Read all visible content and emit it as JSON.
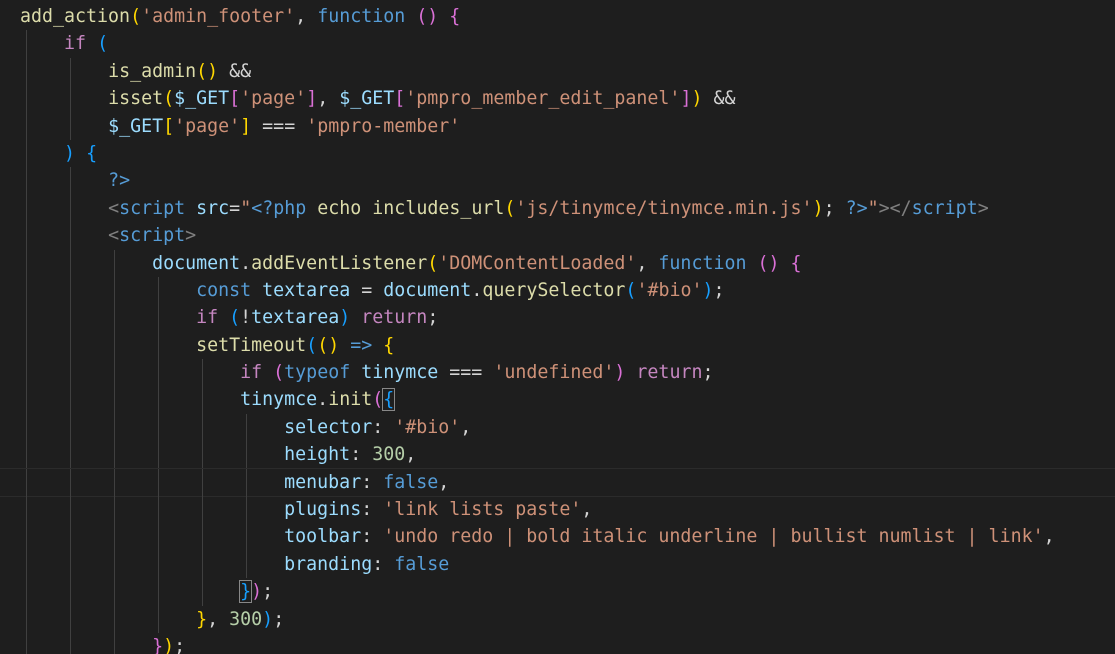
{
  "editor": {
    "theme_colors": {
      "background": "#1e1e1e",
      "function": "#dcdcaa",
      "string": "#ce9178",
      "keyword": "#569cd6",
      "control": "#c586c0",
      "variable": "#9cdcfe",
      "number": "#b5cea8"
    },
    "cursor_line": 17,
    "lines": [
      {
        "indent": 0,
        "tokens": [
          [
            "fn",
            "add_action"
          ],
          [
            "br1",
            "("
          ],
          [
            "str",
            "'admin_footer'"
          ],
          [
            "punc",
            ", "
          ],
          [
            "kw",
            "function"
          ],
          [
            "punc",
            " "
          ],
          [
            "br2",
            "()"
          ],
          [
            "punc",
            " "
          ],
          [
            "br2",
            "{"
          ]
        ]
      },
      {
        "indent": 1,
        "tokens": [
          [
            "ctl",
            "if"
          ],
          [
            "punc",
            " "
          ],
          [
            "br3",
            "("
          ]
        ]
      },
      {
        "indent": 2,
        "tokens": [
          [
            "fn",
            "is_admin"
          ],
          [
            "br1",
            "()"
          ],
          [
            "punc",
            " &&"
          ]
        ]
      },
      {
        "indent": 2,
        "tokens": [
          [
            "fn",
            "isset"
          ],
          [
            "br1",
            "("
          ],
          [
            "var",
            "$_GET"
          ],
          [
            "br2",
            "["
          ],
          [
            "str",
            "'page'"
          ],
          [
            "br2",
            "]"
          ],
          [
            "punc",
            ", "
          ],
          [
            "var",
            "$_GET"
          ],
          [
            "br2",
            "["
          ],
          [
            "str",
            "'pmpro_member_edit_panel'"
          ],
          [
            "br2",
            "]"
          ],
          [
            "br1",
            ")"
          ],
          [
            "punc",
            " &&"
          ]
        ]
      },
      {
        "indent": 2,
        "tokens": [
          [
            "var",
            "$_GET"
          ],
          [
            "br1",
            "["
          ],
          [
            "str",
            "'page'"
          ],
          [
            "br1",
            "]"
          ],
          [
            "punc",
            " === "
          ],
          [
            "str",
            "'pmpro-member'"
          ]
        ]
      },
      {
        "indent": 1,
        "tokens": [
          [
            "br3",
            ")"
          ],
          [
            "punc",
            " "
          ],
          [
            "br3",
            "{"
          ]
        ]
      },
      {
        "indent": 2,
        "tokens": [
          [
            "tag",
            "?>"
          ]
        ]
      },
      {
        "indent": 2,
        "tokens": [
          [
            "tagbr",
            "<"
          ],
          [
            "tag",
            "script"
          ],
          [
            "punc",
            " "
          ],
          [
            "var",
            "src"
          ],
          [
            "punc",
            "="
          ],
          [
            "str",
            "\""
          ],
          [
            "tag",
            "<?php"
          ],
          [
            "punc",
            " "
          ],
          [
            "fn",
            "echo"
          ],
          [
            "punc",
            " "
          ],
          [
            "fn",
            "includes_url"
          ],
          [
            "br1",
            "("
          ],
          [
            "str",
            "'js/tinymce/tinymce.min.js'"
          ],
          [
            "br1",
            ")"
          ],
          [
            "punc",
            "; "
          ],
          [
            "tag",
            "?>"
          ],
          [
            "str",
            "\""
          ],
          [
            "tagbr",
            "></"
          ],
          [
            "tag",
            "script"
          ],
          [
            "tagbr",
            ">"
          ]
        ]
      },
      {
        "indent": 2,
        "tokens": [
          [
            "tagbr",
            "<"
          ],
          [
            "tag",
            "script"
          ],
          [
            "tagbr",
            ">"
          ]
        ]
      },
      {
        "indent": 3,
        "tokens": [
          [
            "var",
            "document"
          ],
          [
            "punc",
            "."
          ],
          [
            "fn",
            "addEventListener"
          ],
          [
            "br1",
            "("
          ],
          [
            "str",
            "'DOMContentLoaded'"
          ],
          [
            "punc",
            ", "
          ],
          [
            "kw",
            "function"
          ],
          [
            "punc",
            " "
          ],
          [
            "br2",
            "()"
          ],
          [
            "punc",
            " "
          ],
          [
            "br2",
            "{"
          ]
        ]
      },
      {
        "indent": 4,
        "tokens": [
          [
            "kw",
            "const"
          ],
          [
            "punc",
            " "
          ],
          [
            "var",
            "textarea"
          ],
          [
            "punc",
            " = "
          ],
          [
            "var",
            "document"
          ],
          [
            "punc",
            "."
          ],
          [
            "fn",
            "querySelector"
          ],
          [
            "br3",
            "("
          ],
          [
            "str",
            "'#bio'"
          ],
          [
            "br3",
            ")"
          ],
          [
            "punc",
            ";"
          ]
        ]
      },
      {
        "indent": 4,
        "tokens": [
          [
            "ctl",
            "if"
          ],
          [
            "punc",
            " "
          ],
          [
            "br3",
            "("
          ],
          [
            "punc",
            "!"
          ],
          [
            "var",
            "textarea"
          ],
          [
            "br3",
            ")"
          ],
          [
            "punc",
            " "
          ],
          [
            "ctl",
            "return"
          ],
          [
            "punc",
            ";"
          ]
        ]
      },
      {
        "indent": 4,
        "tokens": [
          [
            "fn",
            "setTimeout"
          ],
          [
            "br3",
            "("
          ],
          [
            "br1",
            "()"
          ],
          [
            "punc",
            " "
          ],
          [
            "kw",
            "=>"
          ],
          [
            "punc",
            " "
          ],
          [
            "br1",
            "{"
          ]
        ]
      },
      {
        "indent": 5,
        "tokens": [
          [
            "ctl",
            "if"
          ],
          [
            "punc",
            " "
          ],
          [
            "br2",
            "("
          ],
          [
            "kw",
            "typeof"
          ],
          [
            "punc",
            " "
          ],
          [
            "var",
            "tinymce"
          ],
          [
            "punc",
            " === "
          ],
          [
            "str",
            "'undefined'"
          ],
          [
            "br2",
            ")"
          ],
          [
            "punc",
            " "
          ],
          [
            "ctl",
            "return"
          ],
          [
            "punc",
            ";"
          ]
        ]
      },
      {
        "indent": 5,
        "tokens": [
          [
            "var",
            "tinymce"
          ],
          [
            "punc",
            "."
          ],
          [
            "fn",
            "init"
          ],
          [
            "br2",
            "("
          ],
          [
            "br3m",
            "{"
          ]
        ]
      },
      {
        "indent": 6,
        "tokens": [
          [
            "var",
            "selector"
          ],
          [
            "punc",
            ": "
          ],
          [
            "str",
            "'#bio'"
          ],
          [
            "punc",
            ","
          ]
        ]
      },
      {
        "indent": 6,
        "tokens": [
          [
            "var",
            "height"
          ],
          [
            "punc",
            ": "
          ],
          [
            "num",
            "300"
          ],
          [
            "punc",
            ","
          ]
        ]
      },
      {
        "indent": 6,
        "tokens": [
          [
            "var",
            "menubar"
          ],
          [
            "punc",
            ": "
          ],
          [
            "kw",
            "false"
          ],
          [
            "punc",
            ","
          ]
        ]
      },
      {
        "indent": 6,
        "tokens": [
          [
            "var",
            "plugins"
          ],
          [
            "punc",
            ": "
          ],
          [
            "str",
            "'link lists paste'"
          ],
          [
            "punc",
            ","
          ]
        ]
      },
      {
        "indent": 6,
        "tokens": [
          [
            "var",
            "toolbar"
          ],
          [
            "punc",
            ": "
          ],
          [
            "str",
            "'undo redo | bold italic underline | bullist numlist | link'"
          ],
          [
            "punc",
            ","
          ]
        ]
      },
      {
        "indent": 6,
        "tokens": [
          [
            "var",
            "branding"
          ],
          [
            "punc",
            ": "
          ],
          [
            "kw",
            "false"
          ]
        ]
      },
      {
        "indent": 5,
        "tokens": [
          [
            "br3m",
            "}"
          ],
          [
            "br2",
            ")"
          ],
          [
            "punc",
            ";"
          ]
        ]
      },
      {
        "indent": 4,
        "tokens": [
          [
            "br1",
            "}"
          ],
          [
            "punc",
            ", "
          ],
          [
            "num",
            "300"
          ],
          [
            "br3",
            ")"
          ],
          [
            "punc",
            ";"
          ]
        ]
      },
      {
        "indent": 3,
        "tokens": [
          [
            "br2",
            "}"
          ],
          [
            "br1",
            ")"
          ],
          [
            "punc",
            ";"
          ]
        ]
      }
    ]
  }
}
